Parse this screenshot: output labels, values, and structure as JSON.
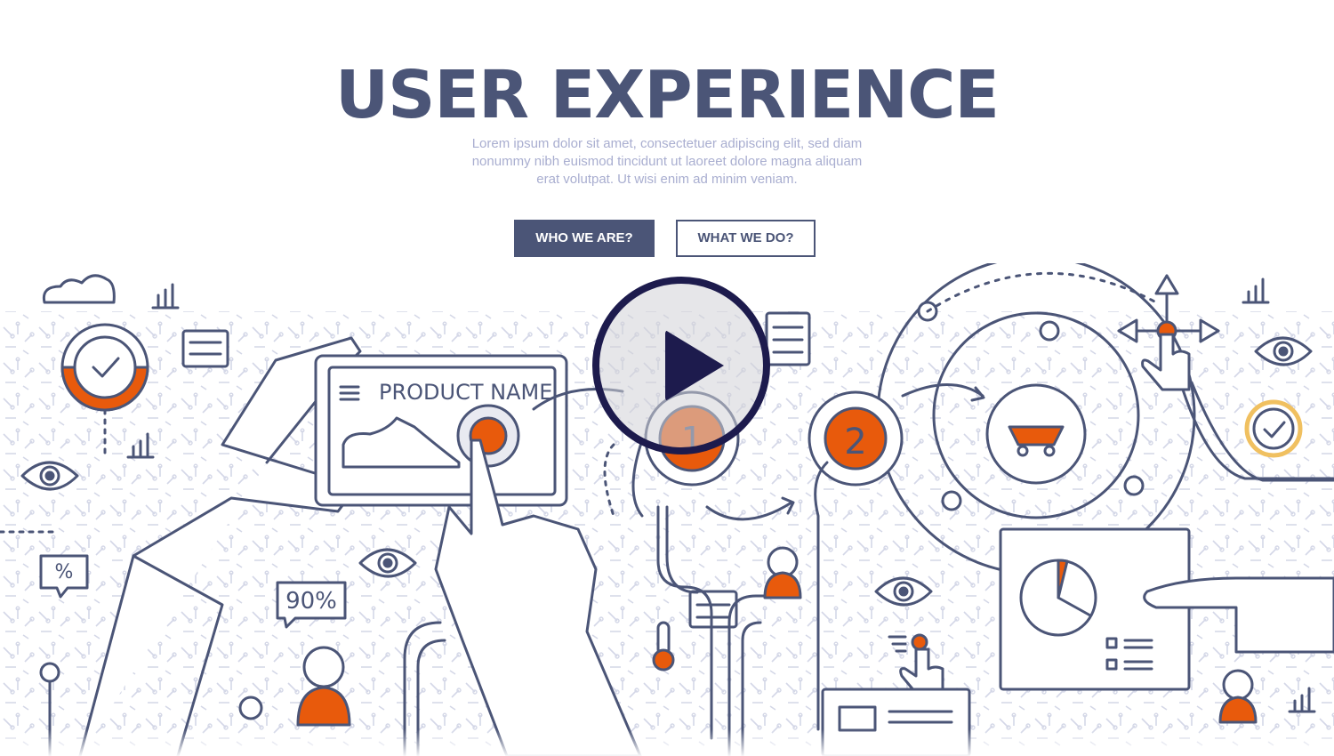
{
  "hero": {
    "title": "USER EXPERIENCE",
    "subtitle": "Lorem ipsum dolor sit amet, consectetuer adipiscing elit, sed diam nonummy nibh euismod tincidunt ut laoreet dolore magna aliquam erat volutpat. Ut wisi enim ad minim veniam.",
    "buttons": {
      "who_label": "WHO WE ARE?",
      "what_label": "WHAT WE DO?"
    }
  },
  "illustration": {
    "product_label": "PRODUCT NAME",
    "step_1": "1",
    "step_2": "2",
    "percent_bubble": "%",
    "rating_bubble": "90%"
  },
  "video": {
    "play_icon": "play-icon"
  },
  "colors": {
    "primary": "#4b5577",
    "accent": "#e85a0c",
    "subtitle": "#a9aed0",
    "play": "#1d1b4d",
    "check_gold": "#f0c060"
  }
}
